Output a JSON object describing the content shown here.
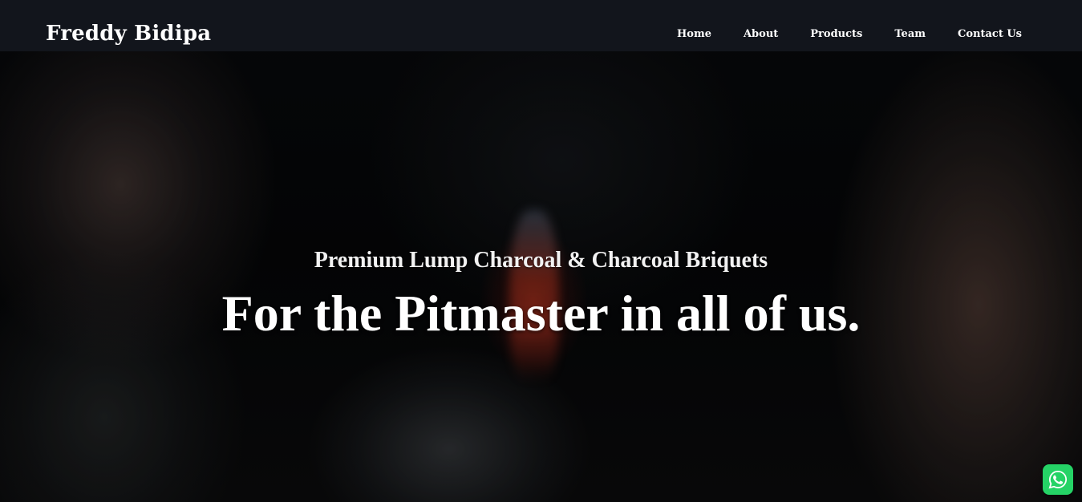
{
  "header": {
    "brand": "Freddy Bidipa",
    "nav": [
      {
        "label": "Home"
      },
      {
        "label": "About"
      },
      {
        "label": "Products"
      },
      {
        "label": "Team"
      },
      {
        "label": "Contact Us"
      }
    ]
  },
  "hero": {
    "subtitle": "Premium Lump Charcoal & Charcoal Briquets",
    "headline": "For the Pitmaster in all of us."
  },
  "floating": {
    "whatsapp_icon": "whatsapp-icon"
  },
  "colors": {
    "navbar_bg": "#12151c",
    "text": "#ffffff",
    "whatsapp": "#25d366"
  }
}
